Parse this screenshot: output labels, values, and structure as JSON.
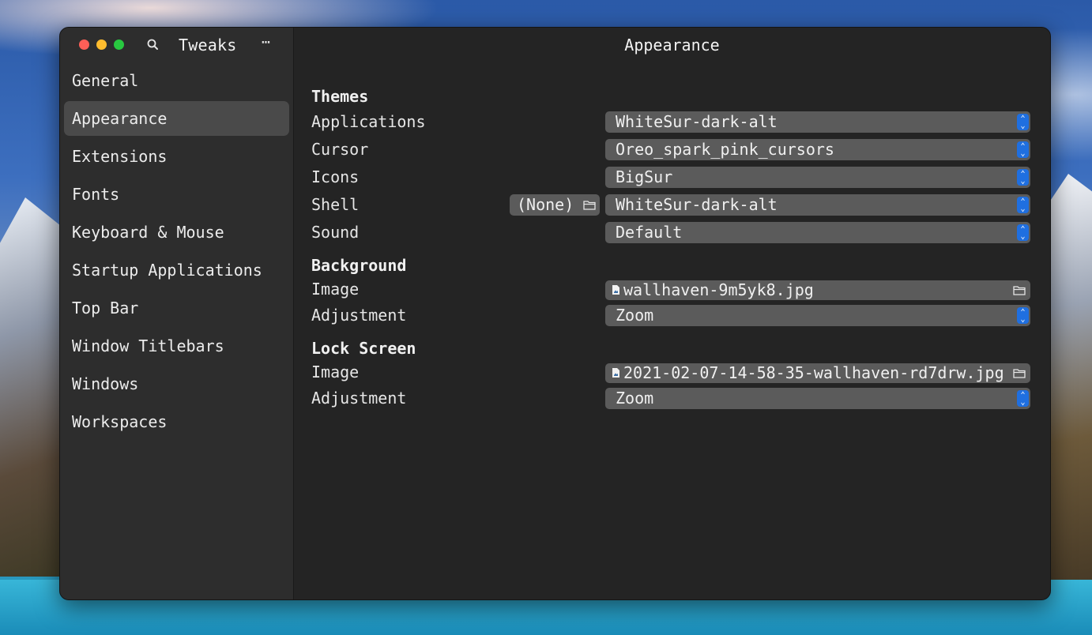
{
  "app": {
    "title": "Tweaks",
    "menu_glyph": "⋯"
  },
  "sidebar": {
    "items": [
      {
        "label": "General",
        "active": false
      },
      {
        "label": "Appearance",
        "active": true
      },
      {
        "label": "Extensions",
        "active": false
      },
      {
        "label": "Fonts",
        "active": false
      },
      {
        "label": "Keyboard & Mouse",
        "active": false
      },
      {
        "label": "Startup Applications",
        "active": false
      },
      {
        "label": "Top Bar",
        "active": false
      },
      {
        "label": "Window Titlebars",
        "active": false
      },
      {
        "label": "Windows",
        "active": false
      },
      {
        "label": "Workspaces",
        "active": false
      }
    ]
  },
  "main": {
    "title": "Appearance",
    "themes": {
      "heading": "Themes",
      "applications": {
        "label": "Applications",
        "value": "WhiteSur-dark-alt"
      },
      "cursor": {
        "label": "Cursor",
        "value": "Oreo_spark_pink_cursors"
      },
      "icons": {
        "label": "Icons",
        "value": "BigSur"
      },
      "shell": {
        "label": "Shell",
        "file_button": "(None)",
        "value": "WhiteSur-dark-alt"
      },
      "sound": {
        "label": "Sound",
        "value": "Default"
      }
    },
    "background": {
      "heading": "Background",
      "image": {
        "label": "Image",
        "value": "wallhaven-9m5yk8.jpg"
      },
      "adjustment": {
        "label": "Adjustment",
        "value": "Zoom"
      }
    },
    "lock_screen": {
      "heading": "Lock Screen",
      "image": {
        "label": "Image",
        "value": "2021-02-07-14-58-35-wallhaven-rd7drw.jpg"
      },
      "adjustment": {
        "label": "Adjustment",
        "value": "Zoom"
      }
    }
  },
  "colors": {
    "window_bg": "#252525",
    "sidebar_bg": "#2d2d2d",
    "active_item": "#4a4a4a",
    "combo_bg": "#5b5b5b",
    "accent": "#1f6fe0",
    "close": "#fe5f57",
    "minimize": "#febc2e",
    "maximize": "#28c840"
  },
  "icons": [
    "search-icon",
    "more-icon",
    "folder-icon",
    "document-icon",
    "updown-arrows-icon"
  ]
}
